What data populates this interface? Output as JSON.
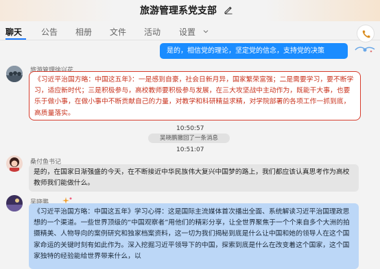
{
  "header": {
    "title": "旅游管理系党支部",
    "edit_icon": "pencil-icon"
  },
  "tabs": [
    {
      "label": "聊天",
      "active": true
    },
    {
      "label": "公告"
    },
    {
      "label": "相册"
    },
    {
      "label": "文件"
    },
    {
      "label": "活动"
    },
    {
      "label": "设置"
    }
  ],
  "call_button_icon": "phone-icon",
  "messages": {
    "outgoing": {
      "text": "是的，相信党的理论，坚定党的信念，支持党的决策"
    },
    "msg1": {
      "sender": "旅游管理徐兴花",
      "text": "《习近平治国方略：中国这五年》：一是感到自豪，社会日新月异，国家繁荣富强；二是需要学习，要不断学习，适应新时代；三是积极参与，高校教师要积极参与发展，在三大攻坚战中主动作为，既能干大事，也要乐于做小事，在做小事中不断贡献自己的力量，对教学和科研精益求精，对学院部署的各项工作一抓到底，高质量落实。"
    },
    "time1": "10:50:57",
    "recall_notice": "吴晓鹏撤回了一条消息",
    "time2": "10:51:07",
    "msg2": {
      "sender": "桑付鱼书记",
      "text": "是的，在国家日渐强盛的今天，在不断接近中华民族伟大复兴中国梦的路上，我们都应该认真思考作为高校教师我们能做什么。"
    },
    "msg3": {
      "sender": "吴晓鹏",
      "text": "《习近平治国方略：中国这五年》学习心得：这是国际主流媒体首次播出全面、系统解读习近平治国理政思想的一个渠道。一些世界顶级的“中国观察者”用他们的精彩分享，让全世界聚焦于一个个来自多个大洲的拍摄精美、人物导向的案例研究和独家档案资料，这一切为我们揭秘到底是什么让中国和她的领导人在这个国家命运的关键时刻有如此作为。深入挖掘习近平领导下的中国，探索到底是什么在改变着这个国家，这个国家独特的经验能给世界带来什么，以"
    }
  },
  "colors": {
    "accent": "#1a8cff",
    "highlight_border": "#d63a2a",
    "highlight_text": "#c8331e",
    "self_bubble": "#bcd7f7"
  }
}
